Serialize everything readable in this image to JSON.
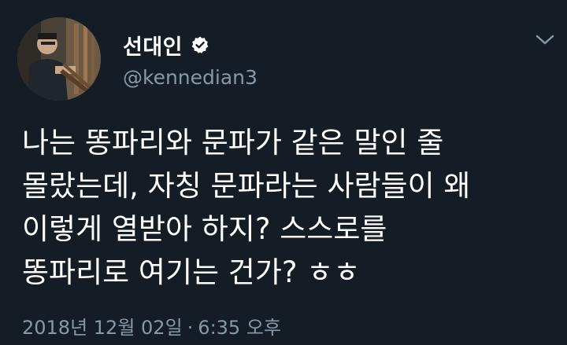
{
  "user": {
    "display_name": "선대인",
    "handle": "@kennedian3",
    "verified": true
  },
  "tweet": {
    "lines": [
      "나는 똥파리와 문파가 같은 말인 줄",
      "몰랐는데, 자칭 문파라는 사람들이 왜",
      "이렇게 열받아 하지? 스스로를",
      "똥파리로 여기는 건가? ㅎㅎ"
    ],
    "date": "2018년 12월 02일",
    "separator": "·",
    "time": "6:35 오후"
  },
  "icons": {
    "verified": "verified-badge-icon",
    "menu": "chevron-down-icon"
  },
  "colors": {
    "background": "#141d26",
    "text": "#ffffff",
    "secondary_text": "#8899a6"
  }
}
